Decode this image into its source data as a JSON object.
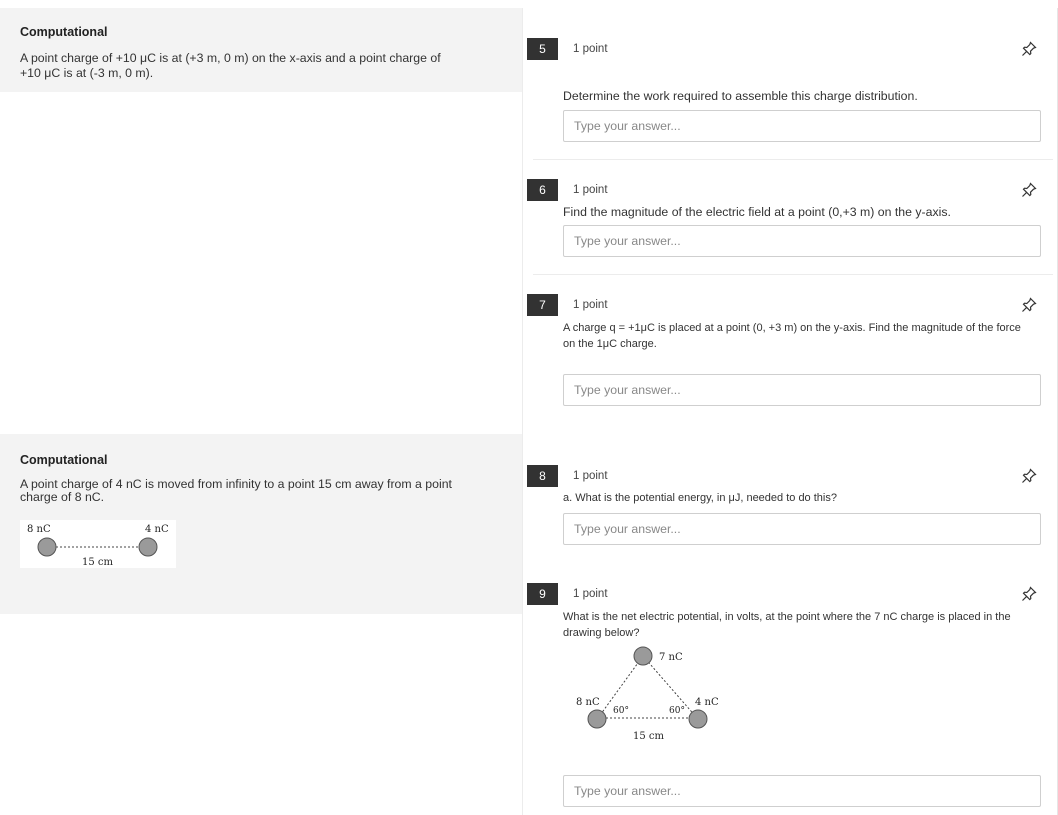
{
  "passages": [
    {
      "heading": "Computational",
      "text_line1": "A point charge of +10 μC is at (+3 m, 0 m) on the x-axis and a point charge of",
      "text_line2": "+10 μC is at (-3 m, 0 m)."
    },
    {
      "heading": "Computational",
      "text_line1": "A point charge of 4 nC is moved from infinity to a point 15 cm away from a point",
      "text_line2": "charge of 8 nC.",
      "figure": {
        "charge_left": "8 nC",
        "charge_right": "4 nC",
        "distance": "15 cm"
      }
    }
  ],
  "questions": [
    {
      "number": "5",
      "points": "1 point",
      "prompt": "Determine the work required to assemble this charge distribution.",
      "placeholder": "Type your answer..."
    },
    {
      "number": "6",
      "points": "1 point",
      "prompt": "Find the magnitude of the electric field at a point (0,+3 m) on the y-axis.",
      "placeholder": "Type your answer..."
    },
    {
      "number": "7",
      "points": "1 point",
      "prompt_line1": "A charge q = +1μC is placed at a point (0, +3 m) on the y-axis. Find the magnitude of the force",
      "prompt_line2": "on the 1μC charge.",
      "placeholder": "Type your answer..."
    },
    {
      "number": "8",
      "points": "1 point",
      "prompt": "a. What is the potential energy, in μJ, needed to do this?",
      "placeholder": "Type your answer..."
    },
    {
      "number": "9",
      "points": "1 point",
      "prompt_line1": "What is the net electric potential, in volts, at the point where the 7 nC charge is placed in the",
      "prompt_line2": "drawing below?",
      "placeholder": "Type your answer...",
      "figure": {
        "charge_top": "7 nC",
        "charge_left": "8 nC",
        "charge_right": "4 nC",
        "angle_left": "60°",
        "angle_right": "60°",
        "distance": "15 cm"
      }
    }
  ],
  "icons": {
    "pin": "pin-icon"
  },
  "colors": {
    "passage_bg": "#f3f3f3",
    "number_badge": "#323232",
    "charge_fill": "#9a9a9a"
  }
}
